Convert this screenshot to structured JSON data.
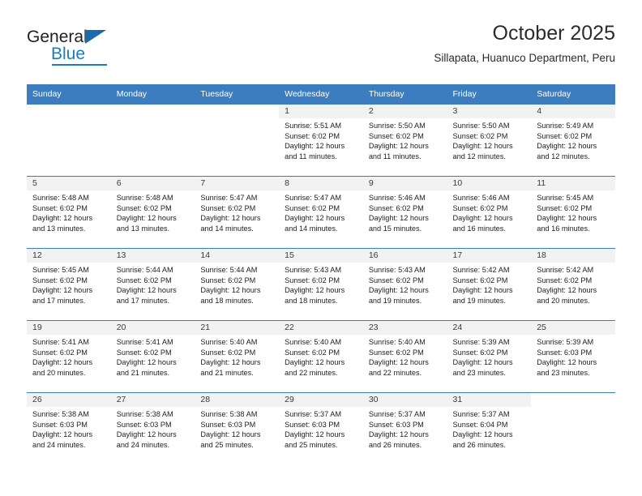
{
  "logo": {
    "primary_text": "General",
    "secondary_text": "Blue",
    "primary_color": "#231f20",
    "secondary_color": "#1a7cc4",
    "triangle_color": "#1a6bad"
  },
  "header": {
    "title": "October 2025",
    "subtitle": "Sillapata, Huanuco Department, Peru"
  },
  "theme": {
    "header_row_bg": "#3c7dbf",
    "header_row_text": "#ffffff",
    "date_band_bg": "#f2f2f2",
    "row_border": "#3c7dbf"
  },
  "calendar": {
    "weekday_headers": [
      "Sunday",
      "Monday",
      "Tuesday",
      "Wednesday",
      "Thursday",
      "Friday",
      "Saturday"
    ],
    "weeks": [
      [
        {
          "empty": true
        },
        {
          "empty": true
        },
        {
          "empty": true
        },
        {
          "date": "1",
          "sunrise": "Sunrise: 5:51 AM",
          "sunset": "Sunset: 6:02 PM",
          "daylight_line1": "Daylight: 12 hours",
          "daylight_line2": "and 11 minutes."
        },
        {
          "date": "2",
          "sunrise": "Sunrise: 5:50 AM",
          "sunset": "Sunset: 6:02 PM",
          "daylight_line1": "Daylight: 12 hours",
          "daylight_line2": "and 11 minutes."
        },
        {
          "date": "3",
          "sunrise": "Sunrise: 5:50 AM",
          "sunset": "Sunset: 6:02 PM",
          "daylight_line1": "Daylight: 12 hours",
          "daylight_line2": "and 12 minutes."
        },
        {
          "date": "4",
          "sunrise": "Sunrise: 5:49 AM",
          "sunset": "Sunset: 6:02 PM",
          "daylight_line1": "Daylight: 12 hours",
          "daylight_line2": "and 12 minutes."
        }
      ],
      [
        {
          "date": "5",
          "sunrise": "Sunrise: 5:48 AM",
          "sunset": "Sunset: 6:02 PM",
          "daylight_line1": "Daylight: 12 hours",
          "daylight_line2": "and 13 minutes."
        },
        {
          "date": "6",
          "sunrise": "Sunrise: 5:48 AM",
          "sunset": "Sunset: 6:02 PM",
          "daylight_line1": "Daylight: 12 hours",
          "daylight_line2": "and 13 minutes."
        },
        {
          "date": "7",
          "sunrise": "Sunrise: 5:47 AM",
          "sunset": "Sunset: 6:02 PM",
          "daylight_line1": "Daylight: 12 hours",
          "daylight_line2": "and 14 minutes."
        },
        {
          "date": "8",
          "sunrise": "Sunrise: 5:47 AM",
          "sunset": "Sunset: 6:02 PM",
          "daylight_line1": "Daylight: 12 hours",
          "daylight_line2": "and 14 minutes."
        },
        {
          "date": "9",
          "sunrise": "Sunrise: 5:46 AM",
          "sunset": "Sunset: 6:02 PM",
          "daylight_line1": "Daylight: 12 hours",
          "daylight_line2": "and 15 minutes."
        },
        {
          "date": "10",
          "sunrise": "Sunrise: 5:46 AM",
          "sunset": "Sunset: 6:02 PM",
          "daylight_line1": "Daylight: 12 hours",
          "daylight_line2": "and 16 minutes."
        },
        {
          "date": "11",
          "sunrise": "Sunrise: 5:45 AM",
          "sunset": "Sunset: 6:02 PM",
          "daylight_line1": "Daylight: 12 hours",
          "daylight_line2": "and 16 minutes."
        }
      ],
      [
        {
          "date": "12",
          "sunrise": "Sunrise: 5:45 AM",
          "sunset": "Sunset: 6:02 PM",
          "daylight_line1": "Daylight: 12 hours",
          "daylight_line2": "and 17 minutes."
        },
        {
          "date": "13",
          "sunrise": "Sunrise: 5:44 AM",
          "sunset": "Sunset: 6:02 PM",
          "daylight_line1": "Daylight: 12 hours",
          "daylight_line2": "and 17 minutes."
        },
        {
          "date": "14",
          "sunrise": "Sunrise: 5:44 AM",
          "sunset": "Sunset: 6:02 PM",
          "daylight_line1": "Daylight: 12 hours",
          "daylight_line2": "and 18 minutes."
        },
        {
          "date": "15",
          "sunrise": "Sunrise: 5:43 AM",
          "sunset": "Sunset: 6:02 PM",
          "daylight_line1": "Daylight: 12 hours",
          "daylight_line2": "and 18 minutes."
        },
        {
          "date": "16",
          "sunrise": "Sunrise: 5:43 AM",
          "sunset": "Sunset: 6:02 PM",
          "daylight_line1": "Daylight: 12 hours",
          "daylight_line2": "and 19 minutes."
        },
        {
          "date": "17",
          "sunrise": "Sunrise: 5:42 AM",
          "sunset": "Sunset: 6:02 PM",
          "daylight_line1": "Daylight: 12 hours",
          "daylight_line2": "and 19 minutes."
        },
        {
          "date": "18",
          "sunrise": "Sunrise: 5:42 AM",
          "sunset": "Sunset: 6:02 PM",
          "daylight_line1": "Daylight: 12 hours",
          "daylight_line2": "and 20 minutes."
        }
      ],
      [
        {
          "date": "19",
          "sunrise": "Sunrise: 5:41 AM",
          "sunset": "Sunset: 6:02 PM",
          "daylight_line1": "Daylight: 12 hours",
          "daylight_line2": "and 20 minutes."
        },
        {
          "date": "20",
          "sunrise": "Sunrise: 5:41 AM",
          "sunset": "Sunset: 6:02 PM",
          "daylight_line1": "Daylight: 12 hours",
          "daylight_line2": "and 21 minutes."
        },
        {
          "date": "21",
          "sunrise": "Sunrise: 5:40 AM",
          "sunset": "Sunset: 6:02 PM",
          "daylight_line1": "Daylight: 12 hours",
          "daylight_line2": "and 21 minutes."
        },
        {
          "date": "22",
          "sunrise": "Sunrise: 5:40 AM",
          "sunset": "Sunset: 6:02 PM",
          "daylight_line1": "Daylight: 12 hours",
          "daylight_line2": "and 22 minutes."
        },
        {
          "date": "23",
          "sunrise": "Sunrise: 5:40 AM",
          "sunset": "Sunset: 6:02 PM",
          "daylight_line1": "Daylight: 12 hours",
          "daylight_line2": "and 22 minutes."
        },
        {
          "date": "24",
          "sunrise": "Sunrise: 5:39 AM",
          "sunset": "Sunset: 6:02 PM",
          "daylight_line1": "Daylight: 12 hours",
          "daylight_line2": "and 23 minutes."
        },
        {
          "date": "25",
          "sunrise": "Sunrise: 5:39 AM",
          "sunset": "Sunset: 6:03 PM",
          "daylight_line1": "Daylight: 12 hours",
          "daylight_line2": "and 23 minutes."
        }
      ],
      [
        {
          "date": "26",
          "sunrise": "Sunrise: 5:38 AM",
          "sunset": "Sunset: 6:03 PM",
          "daylight_line1": "Daylight: 12 hours",
          "daylight_line2": "and 24 minutes."
        },
        {
          "date": "27",
          "sunrise": "Sunrise: 5:38 AM",
          "sunset": "Sunset: 6:03 PM",
          "daylight_line1": "Daylight: 12 hours",
          "daylight_line2": "and 24 minutes."
        },
        {
          "date": "28",
          "sunrise": "Sunrise: 5:38 AM",
          "sunset": "Sunset: 6:03 PM",
          "daylight_line1": "Daylight: 12 hours",
          "daylight_line2": "and 25 minutes."
        },
        {
          "date": "29",
          "sunrise": "Sunrise: 5:37 AM",
          "sunset": "Sunset: 6:03 PM",
          "daylight_line1": "Daylight: 12 hours",
          "daylight_line2": "and 25 minutes."
        },
        {
          "date": "30",
          "sunrise": "Sunrise: 5:37 AM",
          "sunset": "Sunset: 6:03 PM",
          "daylight_line1": "Daylight: 12 hours",
          "daylight_line2": "and 26 minutes."
        },
        {
          "date": "31",
          "sunrise": "Sunrise: 5:37 AM",
          "sunset": "Sunset: 6:04 PM",
          "daylight_line1": "Daylight: 12 hours",
          "daylight_line2": "and 26 minutes."
        },
        {
          "empty": true
        }
      ]
    ]
  }
}
